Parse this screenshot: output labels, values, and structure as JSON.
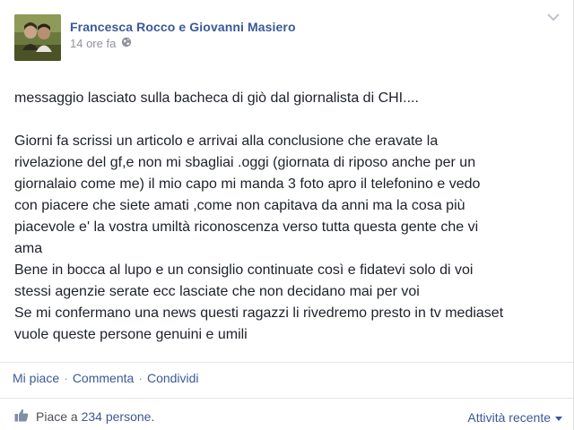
{
  "post": {
    "author": "Francesca Rocco e Giovanni Masiero",
    "timestamp": "14 ore fa",
    "message_lead": "messaggio lasciato sulla bacheca di giò dal giornalista di CHI....",
    "message_body": [
      "Giorni fa scrissi un articolo e arrivai alla conclusione che eravate la",
      "rivelazione del gf,e non mi sbagliai .oggi (giornata di riposo anche per un",
      "giornalaio come me) il mio capo mi manda 3 foto apro il telefonino e vedo",
      "con piacere che siete amati ,come non capitava da anni ma la cosa più",
      "piacevole e' la vostra umiltà riconoscenza verso tutta questa gente che vi",
      "ama",
      "Bene in bocca al lupo e un consiglio continuate così e fidatevi solo di voi",
      "stessi agenzie serate ecc lasciate che non decidano mai per voi",
      "Se mi confermano una news questi ragazzi li rivedremo presto in tv mediaset",
      "vuole queste persone genuini e umili"
    ]
  },
  "actions": {
    "like": "Mi piace",
    "comment": "Commenta",
    "share": "Condividi",
    "separator": "·"
  },
  "likes": {
    "prefix": "Piace a",
    "count": "234 persone",
    "suffix": "."
  },
  "recent_activity": {
    "label": "Attività recente"
  },
  "icons": {
    "globe": "globe-icon",
    "thumbs_up": "thumbs-up-icon",
    "chevron": "chevron-down-icon"
  },
  "colors": {
    "link": "#3b5998",
    "meta": "#90949c",
    "text": "#1d2129"
  }
}
